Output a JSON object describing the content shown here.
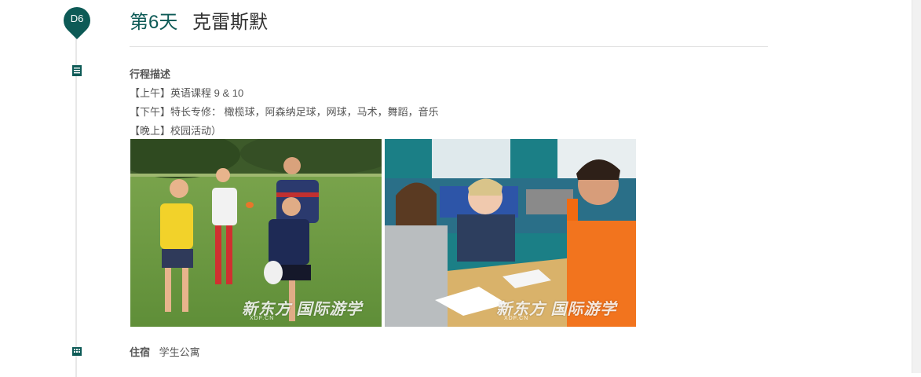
{
  "day_badge": "D6",
  "title": {
    "day": "第6天",
    "city": "克雷斯默"
  },
  "itinerary": {
    "label": "行程描述",
    "lines": [
      "【上午】英语课程 9 & 10",
      "【下午】特长专修： 橄榄球，阿森纳足球，网球，马术，舞蹈，音乐",
      "【晚上】校园活动）"
    ]
  },
  "photos": [
    {
      "name": "rugby-photo",
      "watermark": "新东方 国际游学",
      "watermark_sub": "XDF.CN",
      "watermark_en": "Global Study Tour"
    },
    {
      "name": "classroom-photo",
      "watermark": "新东方 国际游学",
      "watermark_sub": "XDF.CN",
      "watermark_en": "Global Study Tour"
    }
  ],
  "lodging": {
    "label": "住宿",
    "value": "学生公寓"
  },
  "icons": {
    "pin": "map-pin-icon",
    "description": "document-list-icon",
    "lodging": "building-icon"
  },
  "colors": {
    "accent": "#0d5a56",
    "text": "#555555",
    "divider": "#dddddd"
  }
}
